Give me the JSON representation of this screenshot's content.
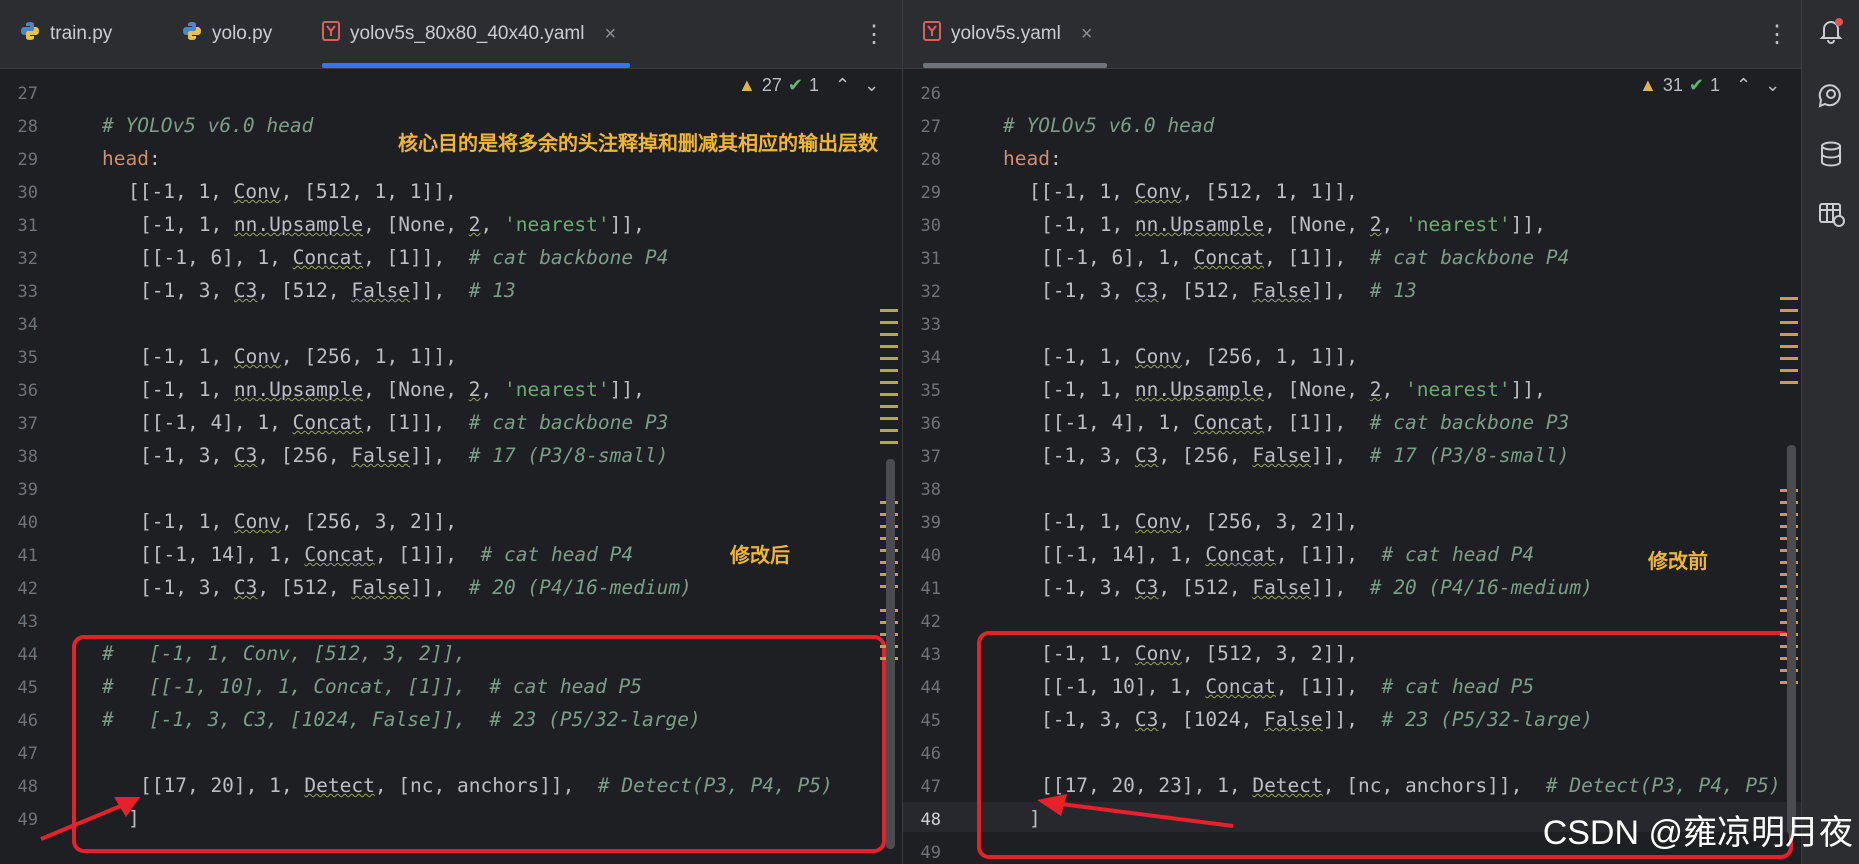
{
  "left": {
    "tabs": [
      {
        "label": "train.py",
        "icon": "python-icon"
      },
      {
        "label": "yolo.py",
        "icon": "python-icon"
      },
      {
        "label": "yolov5s_80x80_40x40.yaml",
        "icon": "yaml-icon",
        "close": "×"
      }
    ],
    "more": "⋮",
    "warnings": "27",
    "checks": "1",
    "line_numbers": [
      "27",
      "28",
      "29",
      "30",
      "31",
      "32",
      "33",
      "34",
      "35",
      "36",
      "37",
      "38",
      "39",
      "40",
      "41",
      "42",
      "43",
      "44",
      "45",
      "46",
      "47",
      "48",
      "49"
    ],
    "annotation_top": "核心目的是将多余的头注释掉和删减其相应的输出层数",
    "annotation_side": "修改后"
  },
  "right": {
    "tabs": [
      {
        "label": "yolov5s.yaml",
        "icon": "yaml-icon",
        "close": "×"
      }
    ],
    "more": "⋮",
    "warnings": "31",
    "checks": "1",
    "line_numbers": [
      "26",
      "27",
      "28",
      "29",
      "30",
      "31",
      "32",
      "33",
      "34",
      "35",
      "36",
      "37",
      "38",
      "39",
      "40",
      "41",
      "42",
      "43",
      "44",
      "45",
      "46",
      "47",
      "48",
      "49"
    ],
    "annotation_side": "修改前"
  },
  "watermark": "CSDN @雍凉明月夜",
  "colors": {
    "accent": "#3574f0",
    "annotation": "#f0b630",
    "highlight": "#e8202a"
  }
}
